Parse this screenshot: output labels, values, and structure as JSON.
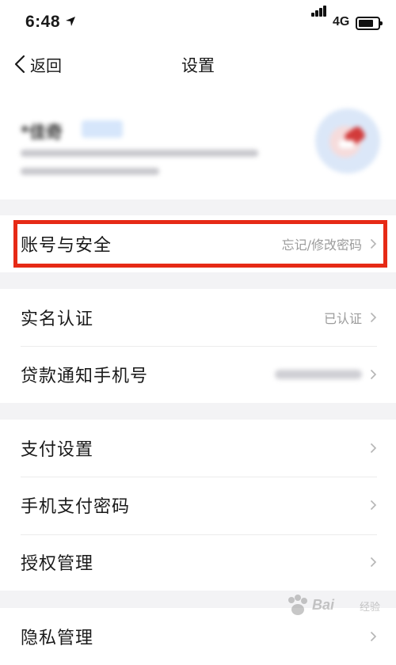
{
  "status_bar": {
    "time": "6:48",
    "network": "4G"
  },
  "nav": {
    "back_label": "返回",
    "title": "设置"
  },
  "profile": {
    "name": "*佳奇"
  },
  "sections": [
    [
      {
        "label": "账号与安全",
        "value": "忘记/修改密码",
        "highlighted": true
      }
    ],
    [
      {
        "label": "实名认证",
        "value": "已认证"
      },
      {
        "label": "贷款通知手机号",
        "value_blurred": true
      }
    ],
    [
      {
        "label": "支付设置"
      },
      {
        "label": "手机支付密码"
      },
      {
        "label": "授权管理"
      }
    ],
    [
      {
        "label": "隐私管理"
      }
    ]
  ],
  "watermark": {
    "brand": "Bai",
    "sub": "经验"
  },
  "colors": {
    "highlight": "#e62a16",
    "chevron": "#b5b5b5",
    "background": "#f3f3f5"
  }
}
